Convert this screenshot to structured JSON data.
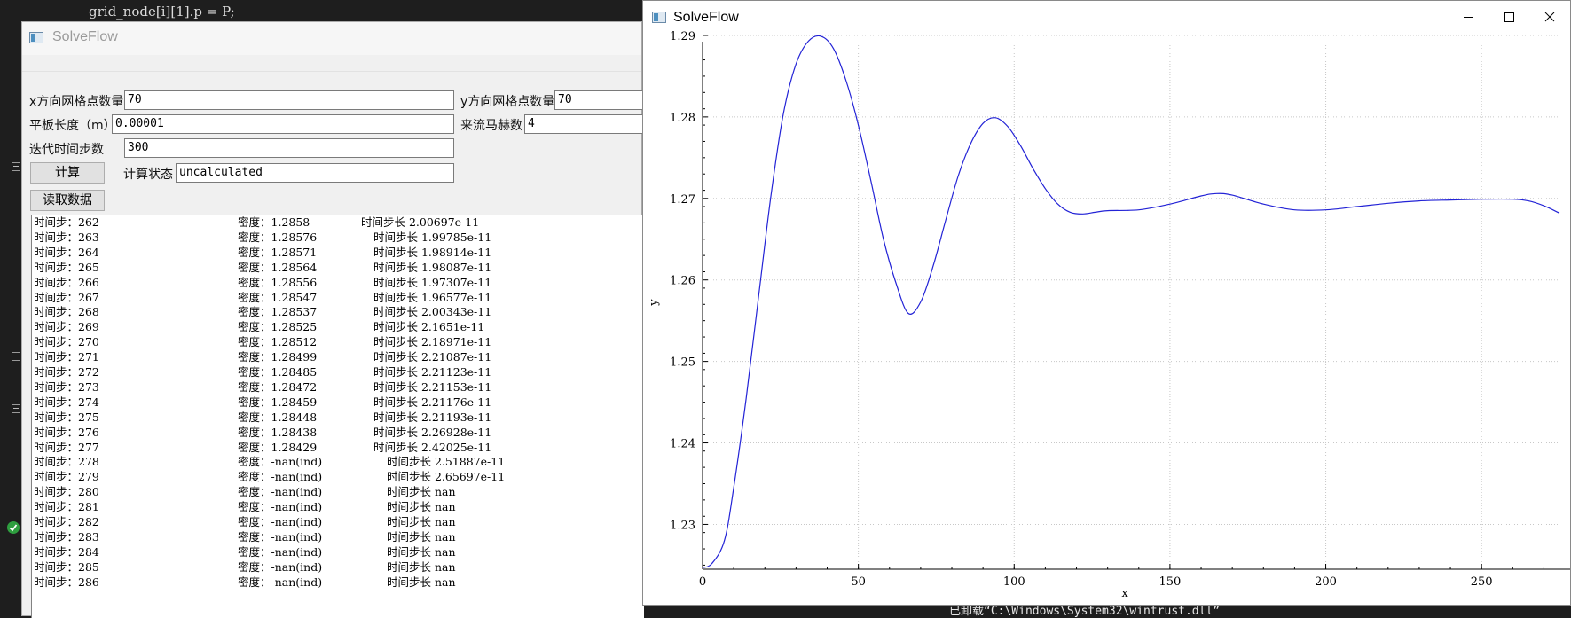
{
  "background": {
    "code_line": "grid_node[i][1].p = P;",
    "output_line": "已卸载“C:\\Windows\\System32\\wintrust.dll”"
  },
  "left_window": {
    "title": "SolveFlow",
    "x_grid_label": "x方向网格点数量",
    "x_grid_value": "70",
    "y_grid_label": "y方向网格点数量",
    "y_grid_value": "70",
    "plate_length_label": "平板长度（m）",
    "plate_length_value": "0.00001",
    "mach_label": "来流马赫数",
    "mach_value": "4",
    "steps_label": "迭代时间步数",
    "steps_value": "300",
    "compute_button": "计算",
    "status_label": "计算状态",
    "status_value": "uncalculated",
    "read_button": "读取数据",
    "log_rows": [
      {
        "step": "时间步：262",
        "density": "密度：1.2858",
        "dt": "时间步长  2.00697e-11"
      },
      {
        "step": "时间步：263",
        "density": "密度：1.28576",
        "dt": "时间步长  1.99785e-11"
      },
      {
        "step": "时间步：264",
        "density": "密度：1.28571",
        "dt": "时间步长  1.98914e-11"
      },
      {
        "step": "时间步：265",
        "density": "密度：1.28564",
        "dt": "时间步长  1.98087e-11"
      },
      {
        "step": "时间步：266",
        "density": "密度：1.28556",
        "dt": "时间步长  1.97307e-11"
      },
      {
        "step": "时间步：267",
        "density": "密度：1.28547",
        "dt": "时间步长  1.96577e-11"
      },
      {
        "step": "时间步：268",
        "density": "密度：1.28537",
        "dt": "时间步长  2.00343e-11"
      },
      {
        "step": "时间步：269",
        "density": "密度：1.28525",
        "dt": "时间步长  2.1651e-11"
      },
      {
        "step": "时间步：270",
        "density": "密度：1.28512",
        "dt": "时间步长  2.18971e-11"
      },
      {
        "step": "时间步：271",
        "density": "密度：1.28499",
        "dt": "时间步长  2.21087e-11"
      },
      {
        "step": "时间步：272",
        "density": "密度：1.28485",
        "dt": "时间步长  2.21123e-11"
      },
      {
        "step": "时间步：273",
        "density": "密度：1.28472",
        "dt": "时间步长  2.21153e-11"
      },
      {
        "step": "时间步：274",
        "density": "密度：1.28459",
        "dt": "时间步长  2.21176e-11"
      },
      {
        "step": "时间步：275",
        "density": "密度：1.28448",
        "dt": "时间步长  2.21193e-11"
      },
      {
        "step": "时间步：276",
        "density": "密度：1.28438",
        "dt": "时间步长  2.26928e-11"
      },
      {
        "step": "时间步：277",
        "density": "密度：1.28429",
        "dt": "时间步长  2.42025e-11"
      },
      {
        "step": "时间步：278",
        "density": "密度：-nan(ind)",
        "dt": "时间步长  2.51887e-11"
      },
      {
        "step": "时间步：279",
        "density": "密度：-nan(ind)",
        "dt": "时间步长  2.65697e-11"
      },
      {
        "step": "时间步：280",
        "density": "密度：-nan(ind)",
        "dt": "时间步长  nan"
      },
      {
        "step": "时间步：281",
        "density": "密度：-nan(ind)",
        "dt": "时间步长  nan"
      },
      {
        "step": "时间步：282",
        "density": "密度：-nan(ind)",
        "dt": "时间步长  nan"
      },
      {
        "step": "时间步：283",
        "density": "密度：-nan(ind)",
        "dt": "时间步长  nan"
      },
      {
        "step": "时间步：284",
        "density": "密度：-nan(ind)",
        "dt": "时间步长  nan"
      },
      {
        "step": "时间步：285",
        "density": "密度：-nan(ind)",
        "dt": "时间步长  nan"
      },
      {
        "step": "时间步：286",
        "density": "密度：-nan(ind)",
        "dt": "时间步长  nan"
      }
    ]
  },
  "right_window": {
    "title": "SolveFlow",
    "controls": [
      "minimize",
      "maximize",
      "close"
    ]
  },
  "colors": {
    "line": "#2323d6",
    "grid": "#c8c8c8",
    "editor_bg": "#1e1e1e",
    "ok_badge": "#2e9e3f"
  },
  "chart_data": {
    "type": "line",
    "title": "",
    "xlabel": "x",
    "ylabel": "y",
    "xlim": [
      0,
      275
    ],
    "ylim": [
      1.2245,
      1.2888
    ],
    "xticks": [
      0,
      50,
      100,
      150,
      200,
      250
    ],
    "yticks": [
      1.23,
      1.24,
      1.25,
      1.26,
      1.27,
      1.28,
      1.29
    ],
    "grid": true,
    "series": [
      {
        "x": [
          0,
          3,
          7,
          10,
          14,
          18,
          22,
          26,
          30,
          34,
          38,
          42,
          46,
          50,
          54,
          58,
          62,
          66,
          70,
          74,
          78,
          82,
          86,
          90,
          94,
          98,
          102,
          106,
          110,
          114,
          118,
          122,
          126,
          130,
          140,
          150,
          160,
          165,
          170,
          180,
          190,
          200,
          210,
          220,
          230,
          240,
          250,
          260,
          265,
          270,
          275
        ],
        "y": [
          1.2247,
          1.2252,
          1.228,
          1.2345,
          1.2455,
          1.258,
          1.2705,
          1.2805,
          1.2865,
          1.2893,
          1.2899,
          1.2884,
          1.2845,
          1.279,
          1.2722,
          1.2651,
          1.2597,
          1.2559,
          1.2573,
          1.2617,
          1.2673,
          1.2727,
          1.2767,
          1.2792,
          1.2799,
          1.2788,
          1.2765,
          1.2737,
          1.2712,
          1.2693,
          1.2683,
          1.2681,
          1.2683,
          1.2685,
          1.2686,
          1.2693,
          1.2703,
          1.2706,
          1.2704,
          1.2693,
          1.2686,
          1.2686,
          1.269,
          1.2694,
          1.2697,
          1.2698,
          1.2699,
          1.2699,
          1.2697,
          1.2691,
          1.2682
        ]
      }
    ]
  }
}
